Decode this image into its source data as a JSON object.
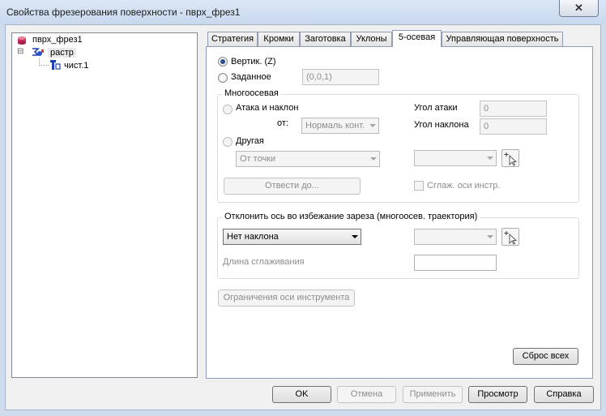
{
  "window": {
    "title": "Свойства фрезерования поверхности - пврх_фрез1",
    "close": "✕"
  },
  "tree": {
    "root": "пврх_фрез1",
    "child": "растр",
    "leaf": "чист.1",
    "expander": "⊟"
  },
  "tabs": [
    {
      "label": "Стратегия"
    },
    {
      "label": "Кромки"
    },
    {
      "label": "Заготовка"
    },
    {
      "label": "Уклоны"
    },
    {
      "label": "5-осевая"
    },
    {
      "label": "Управляющая поверхность"
    }
  ],
  "five_axis": {
    "vertical_label": "Вертик. (Z)",
    "specified_label": "Заданное",
    "specified_value": "(0,0,1)",
    "multi_axis_group": "Многоосевая",
    "lead_lag_label": "Атака и наклон",
    "from_label": "от:",
    "from_value": "Нормаль конт.",
    "lead_angle_label": "Угол атаки",
    "lead_angle_value": "0",
    "tilt_angle_label": "Угол наклона",
    "tilt_angle_value": "0",
    "other_label": "Другая",
    "other_value": "От точки",
    "retract_button": "Отвести до...",
    "smooth_axis_label": "Сглаж. оси инстр.",
    "gouge_group": "Отклонить ось во избежание зареза (многоосев. траектория)",
    "tilt_value": "Нет наклона",
    "smooth_length_label": "Длина сглаживания",
    "smooth_length_value": "",
    "axis_limits_button": "Ограничения оси инструмента",
    "reset_button": "Сброс всех"
  },
  "buttons": {
    "ok": "OK",
    "cancel": "Отмена",
    "apply": "Применить",
    "preview": "Просмотр",
    "help": "Справка"
  },
  "colors": {
    "active_radio": "#2b4f8a",
    "disabled_text": "#8d8d8d",
    "title_bg": "#c8d8ee"
  }
}
